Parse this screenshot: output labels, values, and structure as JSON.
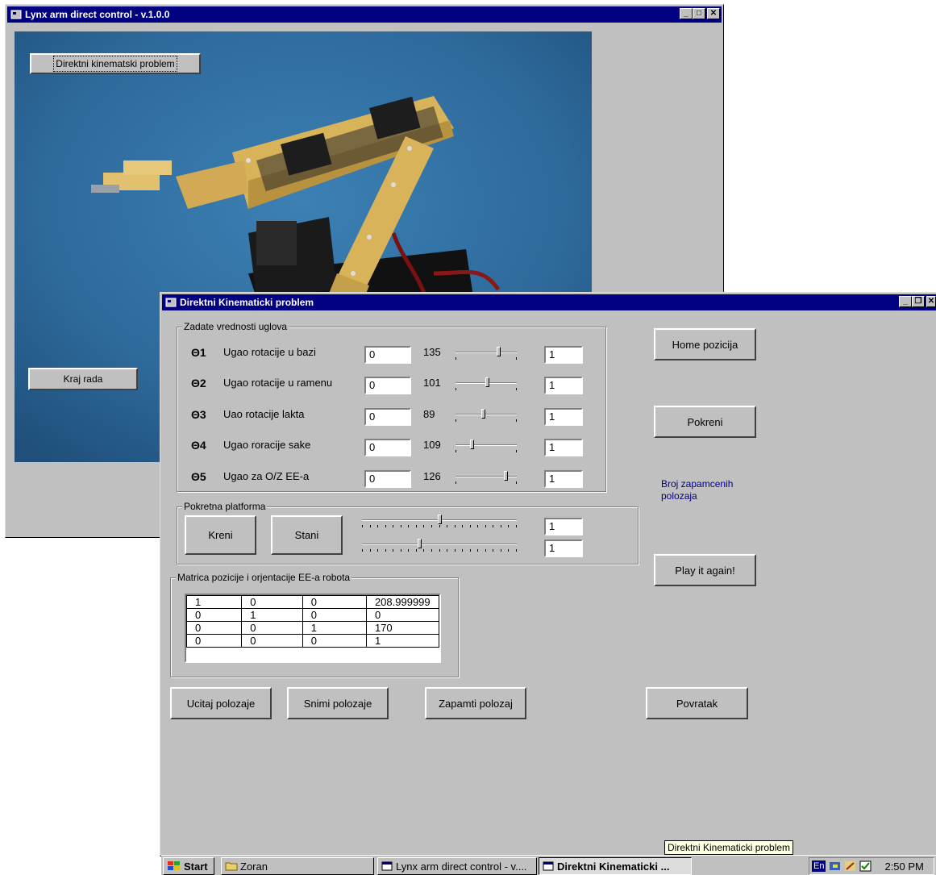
{
  "main_window": {
    "title": "Lynx arm direct control - v.1.0.0",
    "button_direct": "Direktni kinematski problem",
    "button_exit": "Kraj rada"
  },
  "dialog": {
    "title": "Direktni Kinematicki problem",
    "group_angles": "Zadate vrednosti uglova",
    "joints": [
      {
        "symbol": "Θ1",
        "label": "Ugao rotacije u bazi",
        "input": "0",
        "value": "135",
        "step": "1",
        "slider_fraction": 0.72
      },
      {
        "symbol": "Θ2",
        "label": "Ugao rotacije u ramenu",
        "input": "0",
        "value": "101",
        "step": "1",
        "slider_fraction": 0.52
      },
      {
        "symbol": "Θ3",
        "label": "Uao rotacije lakta",
        "input": "0",
        "value": "89",
        "step": "1",
        "slider_fraction": 0.45
      },
      {
        "symbol": "Θ4",
        "label": "Ugao roracije sake",
        "input": "0",
        "value": "109",
        "step": "1",
        "slider_fraction": 0.25
      },
      {
        "symbol": "Θ5",
        "label": "Ugao za O/Z EE-a",
        "input": "0",
        "value": "126",
        "step": "1",
        "slider_fraction": 0.85
      }
    ],
    "group_platform": "Pokretna platforma",
    "button_go": "Kreni",
    "button_stop": "Stani",
    "platform_sliders": [
      {
        "step": "1",
        "slider_fraction": 0.5
      },
      {
        "step": "1",
        "slider_fraction": 0.37
      }
    ],
    "group_matrix": "Matrica pozicije i orjentacije EE-a robota",
    "matrix": [
      [
        "1",
        "0",
        "0",
        "208.999999"
      ],
      [
        "0",
        "1",
        "0",
        "0"
      ],
      [
        "0",
        "0",
        "1",
        "170"
      ],
      [
        "0",
        "0",
        "0",
        "1"
      ]
    ],
    "button_home": "Home pozicija",
    "button_run": "Pokreni",
    "saved_positions_label": "Broj zapamcenih polozaja",
    "button_play": "Play it again!",
    "button_load": "Ucitaj polozaje",
    "button_save": "Snimi polozaje",
    "button_remember": "Zapamti polozaj",
    "button_back": "Povratak"
  },
  "taskbar": {
    "start": "Start",
    "items": [
      "Zoran",
      "Lynx arm direct control - v....",
      "Direktni Kinematicki ..."
    ],
    "tooltip": "Direktni Kinematicki problem",
    "lang": "En",
    "clock": "2:50 PM"
  }
}
